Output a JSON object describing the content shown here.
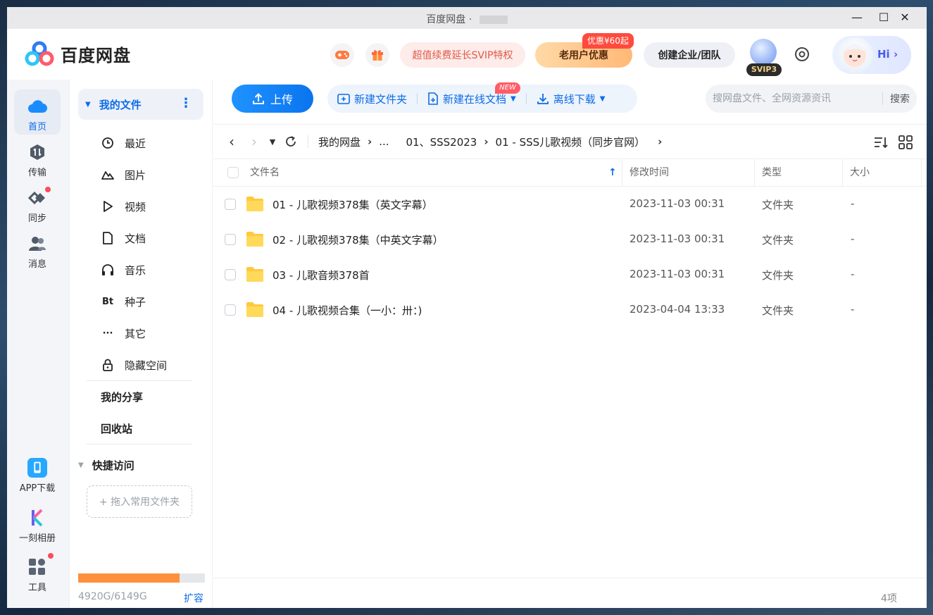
{
  "window": {
    "title": "百度网盘",
    "title_sep": "·",
    "controls": {
      "minimize": "—",
      "maximize": "☐",
      "close": "✕"
    }
  },
  "header": {
    "brand": "百度网盘",
    "svip_promo": "超值续费延长SVIP特权",
    "old_user_offer": "老用户优惠",
    "old_user_badge": "优惠¥60起",
    "create_team": "创建企业/团队",
    "vip_level": "SVIP3",
    "greeting": "Hi",
    "greeting_arrow": "›"
  },
  "rail": {
    "items": [
      {
        "label": "首页",
        "icon": "cloud-icon",
        "active": true
      },
      {
        "label": "传输",
        "icon": "transfer-icon"
      },
      {
        "label": "同步",
        "icon": "sync-icon"
      },
      {
        "label": "消息",
        "icon": "message-icon"
      }
    ],
    "bottom": [
      {
        "label": "APP下载",
        "icon": "phone-icon"
      },
      {
        "label": "一刻相册",
        "icon": "album-icon"
      },
      {
        "label": "工具",
        "icon": "tools-icon"
      }
    ]
  },
  "nav": {
    "my_files": "我的文件",
    "items": [
      {
        "label": "最近",
        "icon": "clock-icon"
      },
      {
        "label": "图片",
        "icon": "image-icon"
      },
      {
        "label": "视频",
        "icon": "play-icon"
      },
      {
        "label": "文档",
        "icon": "document-icon"
      },
      {
        "label": "音乐",
        "icon": "headphones-icon"
      },
      {
        "label": "种子",
        "icon": "torrent-icon",
        "glyph": "Bt"
      },
      {
        "label": "其它",
        "icon": "more-icon",
        "glyph": "···"
      },
      {
        "label": "隐藏空间",
        "icon": "lock-icon"
      }
    ],
    "my_share": "我的分享",
    "recycle": "回收站",
    "quick_access": "快捷访问",
    "drop_zone": "+ 拖入常用文件夹",
    "quota_text": "4920G/6149G",
    "quota_used_fraction": 0.8,
    "expand": "扩容"
  },
  "toolbar": {
    "upload": "上传",
    "new_folder": "新建文件夹",
    "new_doc": "新建在线文档",
    "new_badge": "NEW",
    "offline_download": "离线下载",
    "search_placeholder": "搜网盘文件、全网资源资讯",
    "search_button": "搜索"
  },
  "breadcrumb": {
    "items": [
      "我的网盘",
      "...",
      "01、SSS2023",
      "01 - SSS儿歌视频（同步官网）"
    ]
  },
  "table": {
    "columns": {
      "name": "文件名",
      "mtime": "修改时间",
      "type": "类型",
      "size": "大小"
    },
    "sort_indicator": "↑",
    "rows": [
      {
        "name": "01 - 儿歌视频378集（英文字幕）",
        "mtime": "2023-11-03 00:31",
        "type": "文件夹",
        "size": "-"
      },
      {
        "name": "02 - 儿歌视频378集（中英文字幕）",
        "mtime": "2023-11-03 00:31",
        "type": "文件夹",
        "size": "-"
      },
      {
        "name": "03 - 儿歌音频378首",
        "mtime": "2023-11-03 00:31",
        "type": "文件夹",
        "size": "-"
      },
      {
        "name": "04 - 儿歌视频合集（一小：卅：)",
        "mtime": "2023-04-04 13:33",
        "type": "文件夹",
        "size": "-"
      }
    ]
  },
  "footer": {
    "count": "4项"
  },
  "colors": {
    "accent": "#0c6be8",
    "quota_fill": "#fe8f3d",
    "badge_red": "#ff4a3e"
  }
}
